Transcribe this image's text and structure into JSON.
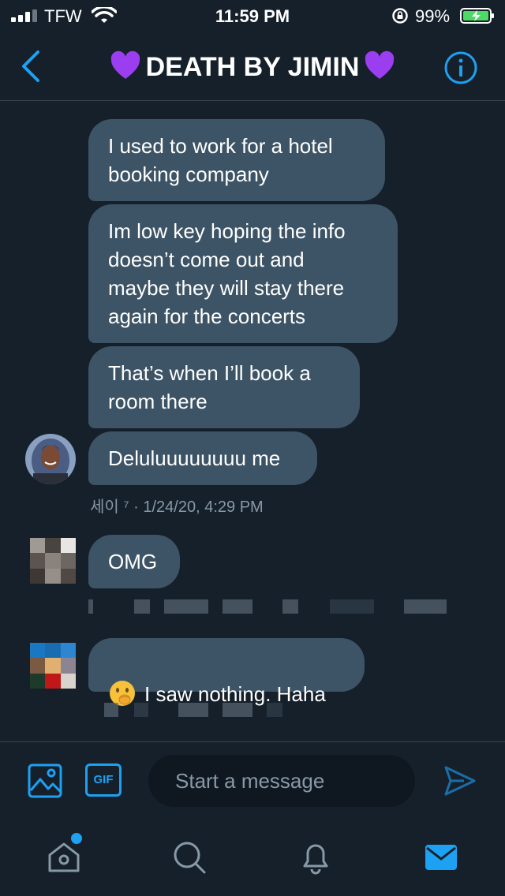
{
  "status_bar": {
    "carrier": "TFW",
    "time": "11:59 PM",
    "battery_percent": "99%",
    "battery_level": 0.99,
    "signal_bars": 3
  },
  "header": {
    "title": "DEATH BY JIMIN",
    "title_emoji_left": "purple-heart",
    "title_emoji_right": "purple-heart",
    "back_icon": "chevron-left-icon",
    "info_icon": "info-icon"
  },
  "messages": [
    {
      "text": "I used to work for a hotel\nbooking company"
    },
    {
      "text": "Im low key hoping the info\ndoesn’t come out and\nmaybe they will stay there\nagain for the concerts"
    },
    {
      "text": "That’s when I’ll book a\nroom there"
    },
    {
      "text": "Deluluuuuuuuu me"
    },
    {
      "text": "OMG"
    },
    {
      "text": "I saw nothing. Haha",
      "emoji": "shushing-face"
    }
  ],
  "meta": {
    "sender_timestamp": "세이 ⁷ · 1/24/20, 4:29 PM"
  },
  "composer": {
    "placeholder": "Start a message",
    "gif_label": "GIF"
  },
  "tabbar": {
    "items": [
      "home-icon",
      "search-icon",
      "notifications-icon",
      "messages-icon"
    ],
    "active": "messages-icon",
    "home_has_dot": true
  },
  "colors": {
    "background": "#15202b",
    "bubble": "#3d5466",
    "accent": "#1da1f2",
    "heart": "#9b3ef0",
    "muted": "#8899a6"
  }
}
